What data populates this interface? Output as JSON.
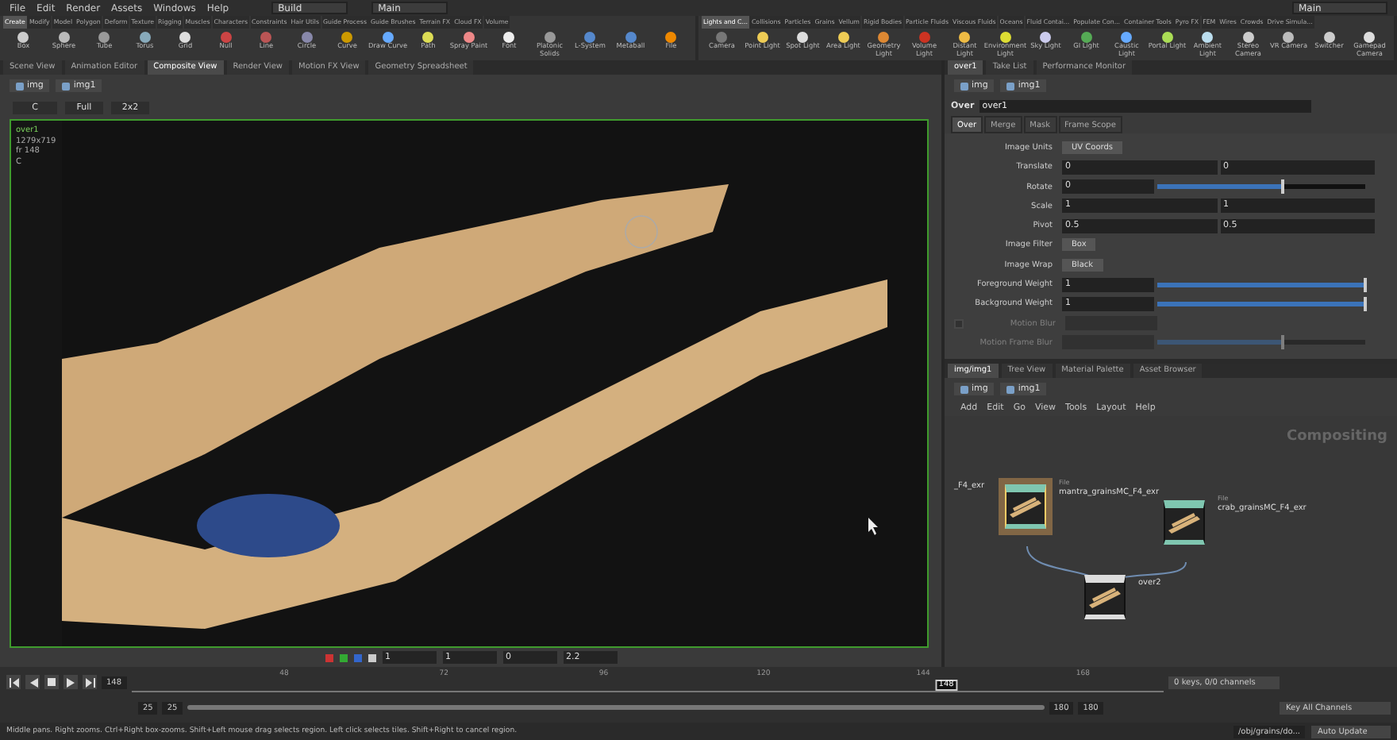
{
  "menubar": {
    "items": [
      "File",
      "Edit",
      "Render",
      "Assets",
      "Windows",
      "Help"
    ],
    "desktop": "Build",
    "context": "Main",
    "right_context": "Main"
  },
  "shelves": [
    {
      "tabs": [
        {
          "label": "Create",
          "selected": true
        },
        {
          "label": "Modify",
          "selected": false
        },
        {
          "label": "Model",
          "selected": false
        },
        {
          "label": "Polygon",
          "selected": false
        },
        {
          "label": "Deform",
          "selected": false
        },
        {
          "label": "Texture",
          "selected": false
        },
        {
          "label": "Rigging",
          "selected": false
        },
        {
          "label": "Muscles",
          "selected": false
        },
        {
          "label": "Characters",
          "selected": false
        },
        {
          "label": "Constraints",
          "selected": false
        },
        {
          "label": "Hair Utils",
          "selected": false
        },
        {
          "label": "Guide Process",
          "selected": false
        },
        {
          "label": "Guide Brushes",
          "selected": false
        },
        {
          "label": "Terrain FX",
          "selected": false
        },
        {
          "label": "Cloud FX",
          "selected": false
        },
        {
          "label": "Volume",
          "selected": false
        }
      ],
      "tools": [
        "Box",
        "Sphere",
        "Tube",
        "Torus",
        "Grid",
        "Null",
        "Line",
        "Circle",
        "Curve",
        "Draw Curve",
        "Path",
        "Spray Paint",
        "Font",
        "Platonic Solids",
        "L-System",
        "Metaball",
        "File"
      ]
    },
    {
      "tabs": [
        {
          "label": "Lights and C...",
          "selected": true
        },
        {
          "label": "Collisions",
          "selected": false
        },
        {
          "label": "Particles",
          "selected": false
        },
        {
          "label": "Grains",
          "selected": false
        },
        {
          "label": "Vellum",
          "selected": false
        },
        {
          "label": "Rigid Bodies",
          "selected": false
        },
        {
          "label": "Particle Fluids",
          "selected": false
        },
        {
          "label": "Viscous Fluids",
          "selected": false
        },
        {
          "label": "Oceans",
          "selected": false
        },
        {
          "label": "Fluid Contai...",
          "selected": false
        },
        {
          "label": "Populate Con...",
          "selected": false
        },
        {
          "label": "Container Tools",
          "selected": false
        },
        {
          "label": "Pyro FX",
          "selected": false
        },
        {
          "label": "FEM",
          "selected": false
        },
        {
          "label": "Wires",
          "selected": false
        },
        {
          "label": "Crowds",
          "selected": false
        },
        {
          "label": "Drive Simula...",
          "selected": false
        }
      ],
      "tools": [
        "Camera",
        "Point Light",
        "Spot Light",
        "Area Light",
        "Geometry Light",
        "Volume Light",
        "Distant Light",
        "Environment Light",
        "Sky Light",
        "GI Light",
        "Caustic Light",
        "Portal Light",
        "Ambient Light",
        "Stereo Camera",
        "VR Camera",
        "Switcher",
        "Gamepad Camera"
      ]
    }
  ],
  "viewer": {
    "tabs": [
      {
        "label": "Scene View",
        "selected": false
      },
      {
        "label": "Animation Editor",
        "selected": false
      },
      {
        "label": "Composite View",
        "selected": true
      },
      {
        "label": "Render View",
        "selected": false
      },
      {
        "label": "Motion FX View",
        "selected": false
      },
      {
        "label": "Geometry Spreadsheet",
        "selected": false
      }
    ],
    "path": [
      "img",
      "img1"
    ],
    "toolbar": [
      "C",
      "Full",
      "2x2"
    ],
    "info": [
      "over1",
      "1279x719",
      "fr 148",
      "C"
    ],
    "bottom_toolbar": [
      "1",
      "1",
      "0",
      "2.2"
    ]
  },
  "parameters": {
    "tabs": [
      {
        "label": "over1",
        "selected": true
      },
      {
        "label": "Take List",
        "selected": false
      },
      {
        "label": "Performance Monitor",
        "selected": false
      }
    ],
    "path": [
      "img",
      "img1"
    ],
    "node_type": "Over",
    "node_name": "over1",
    "param_tabs": [
      {
        "label": "Over",
        "selected": true
      },
      {
        "label": "Merge",
        "selected": false
      },
      {
        "label": "Mask",
        "selected": false
      },
      {
        "label": "Frame Scope",
        "selected": false
      }
    ],
    "params": [
      {
        "kind": "menu",
        "label": "Image Units",
        "value": "UV Coords",
        "disabled": false
      },
      {
        "kind": "vector",
        "label": "Translate",
        "values": [
          "0",
          "0"
        ],
        "disabled": false
      },
      {
        "kind": "slider",
        "label": "Rotate",
        "value": "0",
        "level": 0.6,
        "disabled": false
      },
      {
        "kind": "vector",
        "label": "Scale",
        "values": [
          "1",
          "1"
        ],
        "disabled": false
      },
      {
        "kind": "vector",
        "label": "Pivot",
        "values": [
          "0.5",
          "0.5"
        ],
        "disabled": false
      },
      {
        "kind": "menu",
        "label": "Image Filter",
        "value": "Box",
        "disabled": false
      },
      {
        "kind": "menu",
        "label": "Image Wrap",
        "value": "Black",
        "disabled": false
      },
      {
        "kind": "slider",
        "label": "Foreground Weight",
        "value": "1",
        "level": 1,
        "disabled": false
      },
      {
        "kind": "slider",
        "label": "Background Weight",
        "value": "1",
        "level": 1,
        "disabled": false
      },
      {
        "kind": "toggle",
        "label": "Motion Blur",
        "checked": false,
        "disabled": true
      },
      {
        "kind": "slider",
        "label": "Motion Frame Blur",
        "level": 0.6,
        "disabled": true
      }
    ]
  },
  "network": {
    "tabs": [
      {
        "label": "img/img1",
        "selected": true
      },
      {
        "label": "Tree View",
        "selected": false
      },
      {
        "label": "Material Palette",
        "selected": false
      },
      {
        "label": "Asset Browser",
        "selected": false
      }
    ],
    "path": [
      "img",
      "img1"
    ],
    "menu": [
      "Add",
      "Edit",
      "Go",
      "View",
      "Tools",
      "Layout",
      "Help"
    ],
    "context_label": "Compositing",
    "stray_label": "_F4_exr",
    "nodes": [
      {
        "type": "File",
        "label": "mantra_grainsMC_F4_exr",
        "selected": true,
        "kind": "file"
      },
      {
        "type": "File",
        "label": "crab_grainsMC_F4_exr",
        "selected": false,
        "kind": "file"
      },
      {
        "label": "over2",
        "selected": false,
        "kind": "over"
      }
    ]
  },
  "timeline": {
    "current_frame": "148",
    "ticks": [
      "48",
      "72",
      "96",
      "120",
      "144",
      "168"
    ],
    "marker": "148",
    "level": 0.79,
    "range": [
      "25",
      "25",
      "180",
      "180"
    ],
    "range_slider": {
      "level": 1
    },
    "keys": "0 keys, 0/0 channels",
    "key_button": "Key All Channels"
  },
  "status_bar": {
    "message": "Middle pans. Right zooms. Ctrl+Right box-zooms.    Shift+Left mouse drag selects region. Left click selects tiles. Shift+Right to cancel region.",
    "path": "/obj/grains/do...",
    "update": "Auto Update"
  }
}
